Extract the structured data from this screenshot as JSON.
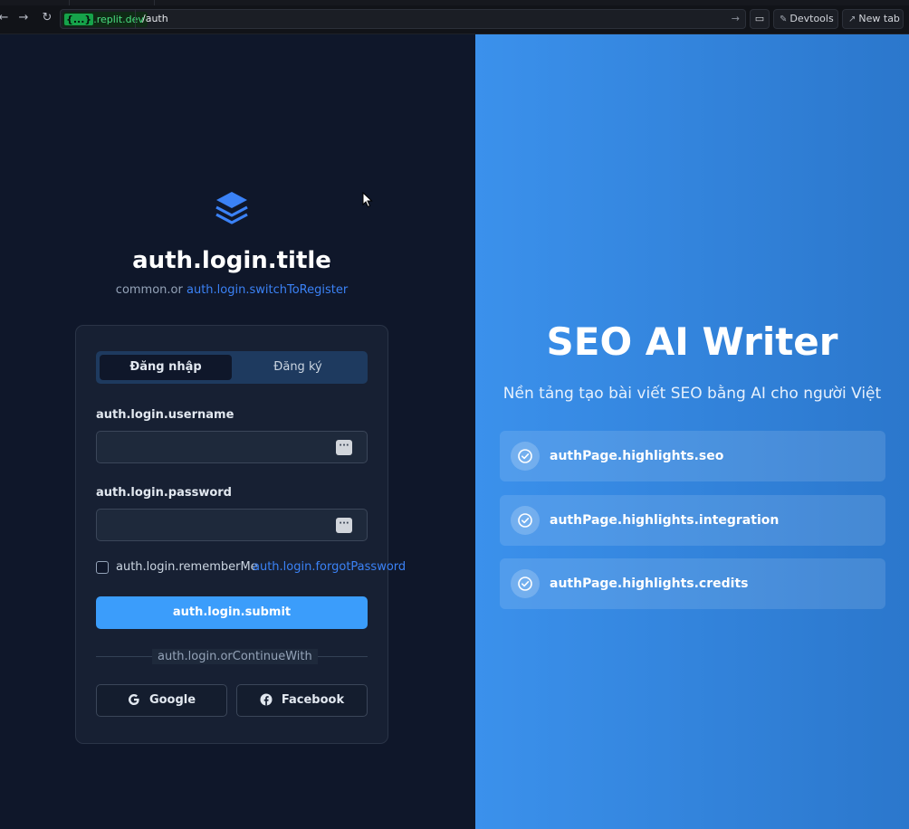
{
  "browser": {
    "domain_brace": "{...}",
    "domain": ".replit.dev",
    "path": "/auth",
    "devtools_label": "Devtools",
    "new_tab_label": "New tab"
  },
  "auth": {
    "logo_icon": "layers-icon",
    "title": "auth.login.title",
    "subtitle_prefix": "common.or",
    "subtitle_link": "auth.login.switchToRegister",
    "tabs": [
      {
        "label": "Đăng nhập",
        "active": true
      },
      {
        "label": "Đăng ký",
        "active": false
      }
    ],
    "username_label": "auth.login.username",
    "username_value": "",
    "password_label": "auth.login.password",
    "password_value": "",
    "remember_label": "auth.login.rememberMe",
    "forgot_label": "auth.login.forgotPassword",
    "submit_label": "auth.login.submit",
    "continue_with": "auth.login.orContinueWith",
    "google_label": "Google",
    "facebook_label": "Facebook"
  },
  "hero": {
    "title": "SEO AI Writer",
    "tagline": "Nền tảng tạo bài viết SEO bằng AI cho người Việt",
    "highlights": [
      {
        "label": "authPage.highlights.seo",
        "icon": "check-circle-icon"
      },
      {
        "label": "authPage.highlights.integration",
        "icon": "check-circle-icon"
      },
      {
        "label": "authPage.highlights.credits",
        "icon": "check-circle-icon"
      }
    ]
  },
  "colors": {
    "accent": "#3b9dfb",
    "link": "#3b82f6",
    "panel_dark": "#0f172a",
    "hero_blue": "#3b91ec"
  }
}
